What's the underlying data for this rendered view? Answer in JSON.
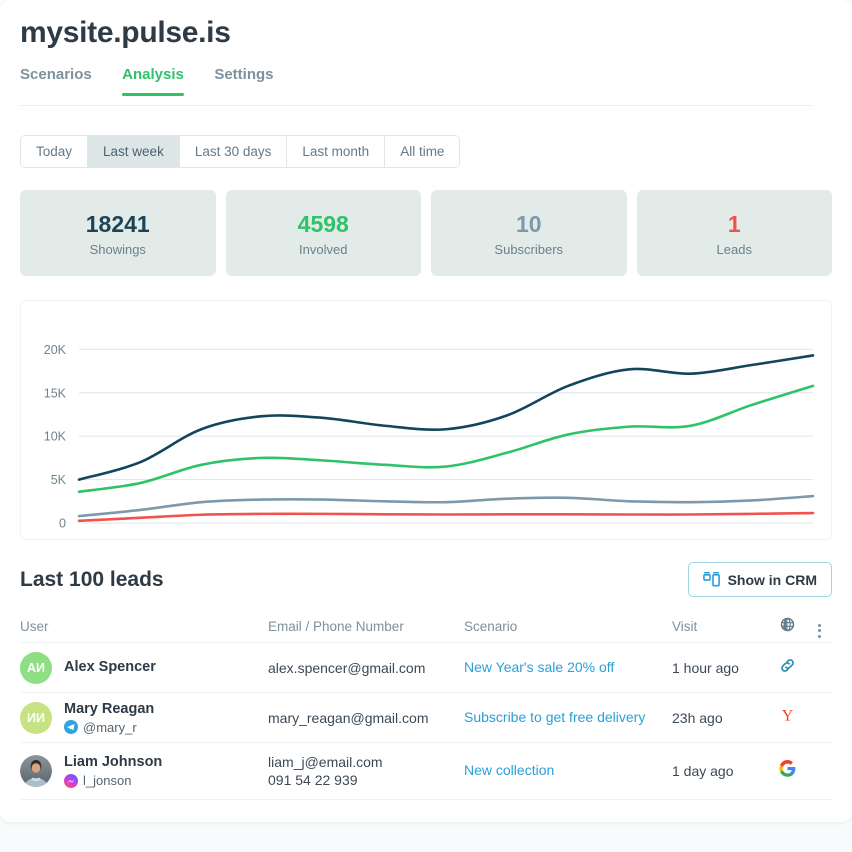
{
  "header": {
    "site_title": "mysite.pulse.is",
    "tabs": [
      {
        "label": "Scenarios",
        "active": false
      },
      {
        "label": "Analysis",
        "active": true
      },
      {
        "label": "Settings",
        "active": false
      }
    ]
  },
  "range_filter": {
    "options": [
      {
        "label": "Today",
        "active": false
      },
      {
        "label": "Last week",
        "active": true
      },
      {
        "label": "Last 30 days",
        "active": false
      },
      {
        "label": "Last month",
        "active": false
      },
      {
        "label": "All time",
        "active": false
      }
    ]
  },
  "stats": [
    {
      "value": "18241",
      "label": "Showings",
      "color": "#1d4456"
    },
    {
      "value": "4598",
      "label": "Involved",
      "color": "#2ec269"
    },
    {
      "value": "10",
      "label": "Subscribers",
      "color": "#7d99ab"
    },
    {
      "value": "1",
      "label": "Leads",
      "color": "#f0524d"
    }
  ],
  "chart_data": {
    "type": "line",
    "title": "",
    "xlabel": "",
    "ylabel": "",
    "ylim": [
      0,
      22000
    ],
    "yticks": [
      0,
      5000,
      10000,
      15000,
      20000
    ],
    "ytick_labels": [
      "0",
      "5K",
      "10K",
      "15K",
      "20K"
    ],
    "grid": true,
    "legend": "none",
    "x": [
      0,
      1,
      2,
      3,
      4,
      5,
      6,
      7,
      8,
      9,
      10,
      11,
      12
    ],
    "series": [
      {
        "name": "Showings",
        "color": "#13455c",
        "values": [
          5000,
          7000,
          10800,
          12300,
          12100,
          11200,
          10800,
          12400,
          15800,
          17700,
          17200,
          18200,
          19300
        ]
      },
      {
        "name": "Involved",
        "color": "#2ec269",
        "values": [
          3600,
          4600,
          6700,
          7500,
          7200,
          6700,
          6500,
          8100,
          10200,
          11100,
          11200,
          13600,
          15800
        ]
      },
      {
        "name": "Subscribers",
        "color": "#7d99ab",
        "values": [
          800,
          1500,
          2400,
          2700,
          2700,
          2500,
          2400,
          2800,
          2900,
          2500,
          2400,
          2600,
          3100
        ]
      },
      {
        "name": "Leads",
        "color": "#f0524d",
        "values": [
          250,
          600,
          950,
          1050,
          1050,
          1000,
          980,
          1000,
          1000,
          980,
          980,
          1050,
          1150
        ]
      }
    ]
  },
  "leads": {
    "title": "Last 100 leads",
    "crm_button": {
      "label": "Show in CRM",
      "icon": "crm-grid-icon",
      "accent": "#2a9fd8"
    },
    "columns": {
      "user": "User",
      "email": "Email / Phone Number",
      "scenario": "Scenario",
      "visit": "Visit",
      "source": "globe-icon",
      "menu": "kebab-menu-icon"
    },
    "rows": [
      {
        "avatar": {
          "type": "initials",
          "text": "АИ",
          "bg": "#8ede84"
        },
        "name": "Alex Spencer",
        "handle": "",
        "handle_icon": "",
        "contact": [
          "alex.spencer@gmail.com"
        ],
        "scenario": "New Year's sale 20% off",
        "visit": "1 hour ago",
        "source_icon": "link-icon"
      },
      {
        "avatar": {
          "type": "initials",
          "text": "ИИ",
          "bg": "#c6e283"
        },
        "name": "Mary Reagan",
        "handle": "@mary_r",
        "handle_icon": "telegram-icon",
        "contact": [
          "mary_reagan@gmail.com"
        ],
        "scenario": "Subscribe to get free delivery",
        "visit": "23h ago",
        "source_icon": "yandex-icon"
      },
      {
        "avatar": {
          "type": "photo",
          "text": "",
          "bg": "#53606b"
        },
        "name": "Liam Johnson",
        "handle": "l_jonson",
        "handle_icon": "messenger-icon",
        "contact": [
          "liam_j@email.com",
          "091 54 22 939"
        ],
        "scenario": "New collection",
        "visit": "1 day ago",
        "source_icon": "google-icon"
      }
    ]
  }
}
